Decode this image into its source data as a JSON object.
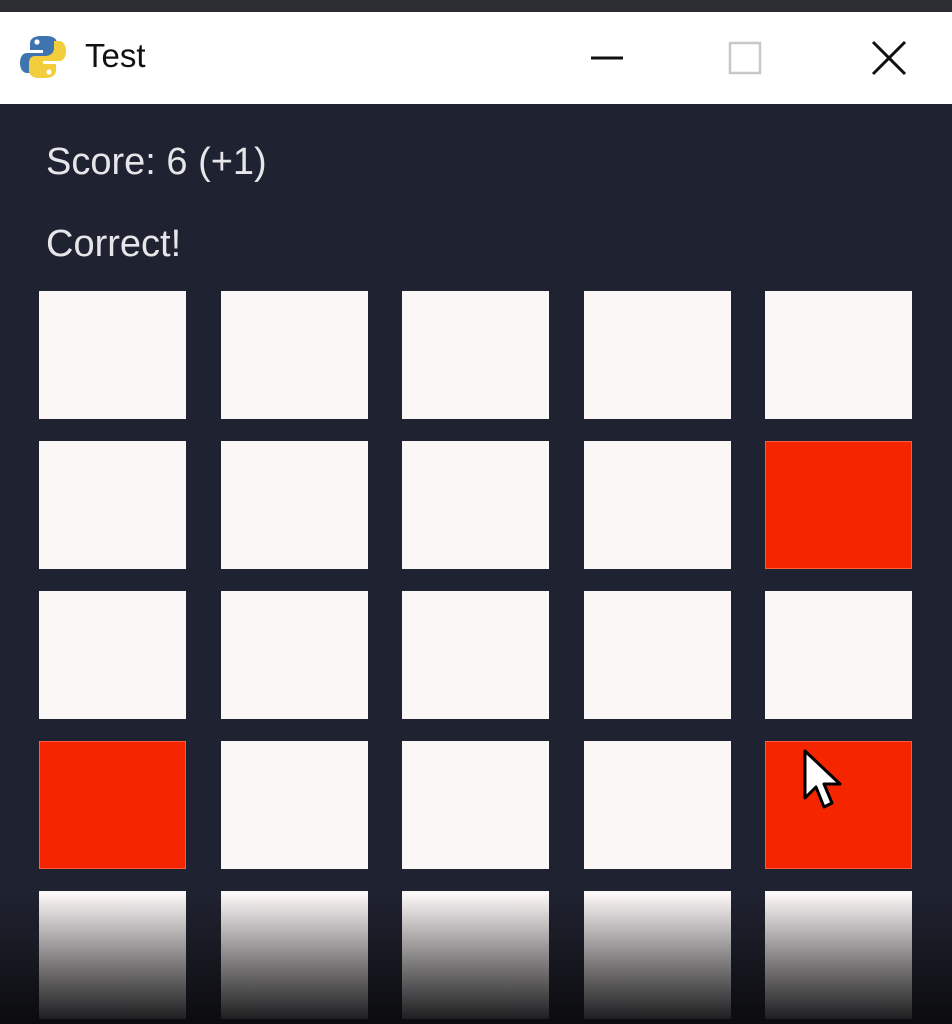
{
  "window": {
    "title": "Test",
    "icon": "python-icon"
  },
  "game": {
    "score_text": "Score: 6 (+1)",
    "status_text": "Correct!",
    "rows": 5,
    "cols": 5,
    "tiles": [
      [
        "white",
        "white",
        "white",
        "white",
        "white"
      ],
      [
        "white",
        "white",
        "white",
        "white",
        "red"
      ],
      [
        "white",
        "white",
        "white",
        "white",
        "white"
      ],
      [
        "red",
        "white",
        "white",
        "white",
        "red"
      ],
      [
        "white",
        "white",
        "white",
        "white",
        "white"
      ]
    ]
  },
  "colors": {
    "background": "#1f2230",
    "tile_white": "#fcf7f7",
    "tile_red": "#f52500",
    "text": "#e6e6ea"
  }
}
